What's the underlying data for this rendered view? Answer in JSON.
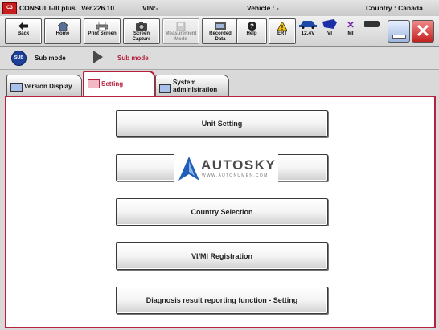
{
  "titlebar": {
    "logo_text": "C3",
    "app_title": "CONSULT-III plus",
    "version": "Ver.226.10",
    "vin": "VIN:-",
    "vehicle": "Vehicle : -",
    "country": "Country : Canada"
  },
  "toolbar": {
    "back": "Back",
    "home": "Home",
    "print_screen": "Print Screen",
    "screen_capture_l1": "Screen",
    "screen_capture_l2": "Capture",
    "measurement_l1": "Measurement",
    "measurement_l2": "Mode",
    "recorded_l1": "Recorded",
    "recorded_l2": "Data",
    "help": "Help",
    "ert": "ERT",
    "voltage": "12.4V",
    "vi": "VI",
    "mi": "MI"
  },
  "subbar": {
    "badge": "SUB",
    "label": "Sub mode",
    "current": "Sub mode"
  },
  "tabs": {
    "version_display": "Version Display",
    "setting": "Setting",
    "system_admin_l1": "System",
    "system_admin_l2": "administration"
  },
  "buttons": {
    "unit_setting": "Unit Setting",
    "hidden_button": "",
    "country_selection": "Country Selection",
    "vimi_registration": "VI/MI Registration",
    "diagnosis_reporting": "Diagnosis result reporting function - Setting"
  },
  "watermark": {
    "brand": "AUTOSKY",
    "url": "WWW.AUTONUMEN.COM"
  },
  "colors": {
    "accent_red": "#b5203c",
    "sub_badge_blue": "#1c3f9a"
  }
}
